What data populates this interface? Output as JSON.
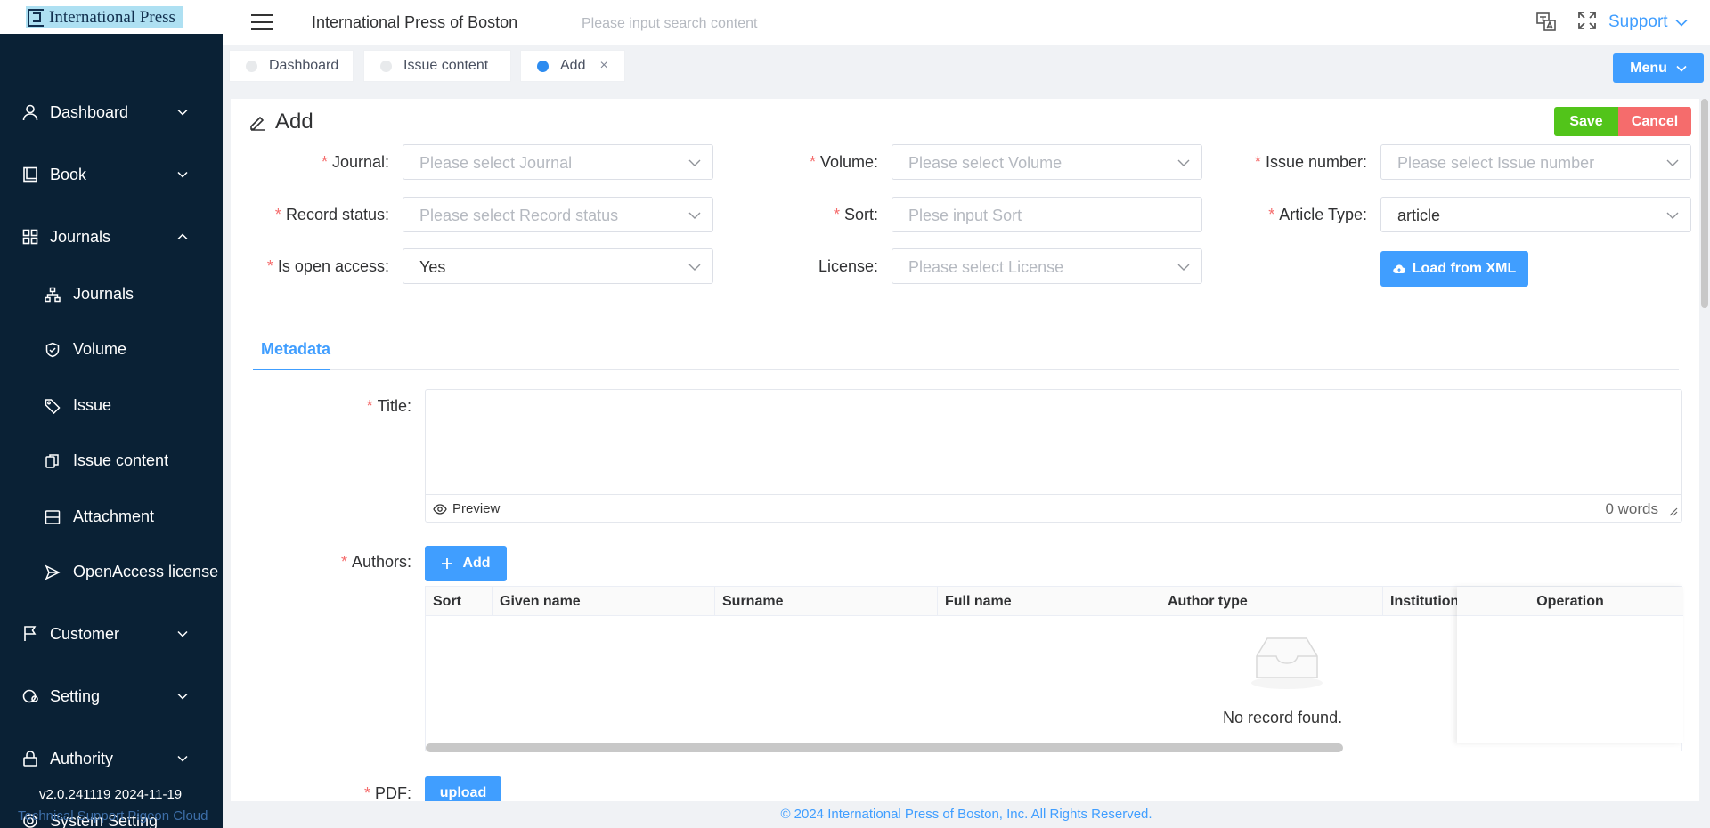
{
  "sidebar": {
    "logo": "International Press",
    "menu": [
      {
        "label": "Dashboard",
        "icon": "user-icon",
        "arrow": "down"
      },
      {
        "label": "Book",
        "icon": "book-icon",
        "arrow": "down"
      },
      {
        "label": "Journals",
        "icon": "grid-icon",
        "arrow": "up"
      }
    ],
    "submenu": [
      {
        "label": "Journals",
        "icon": "sitemap-icon"
      },
      {
        "label": "Volume",
        "icon": "shield-icon"
      },
      {
        "label": "Issue",
        "icon": "tag-icon"
      },
      {
        "label": "Issue content",
        "icon": "copy-icon"
      },
      {
        "label": "Attachment",
        "icon": "attachment-icon"
      },
      {
        "label": "OpenAccess license",
        "icon": "send-icon"
      }
    ],
    "menu2": [
      {
        "label": "Customer",
        "icon": "flag-icon",
        "arrow": "down"
      },
      {
        "label": "Setting",
        "icon": "setting-icon",
        "arrow": "down"
      },
      {
        "label": "Authority",
        "icon": "lock-icon",
        "arrow": "down"
      },
      {
        "label": "System Setting",
        "icon": "gear-icon"
      }
    ],
    "version": "v2.0.241119 2024-11-19",
    "support_line": "Technical Support Pigeon Cloud"
  },
  "header": {
    "title": "International Press of Boston",
    "search_placeholder": "Please input search content",
    "support": "Support"
  },
  "tabs": [
    {
      "label": "Dashboard",
      "active": false
    },
    {
      "label": "Issue content",
      "active": false
    },
    {
      "label": "Add",
      "active": true,
      "close": "×"
    }
  ],
  "menu_button": "Menu",
  "page": {
    "title": "Add",
    "save": "Save",
    "cancel": "Cancel"
  },
  "form": {
    "journal": {
      "label": "Journal:",
      "placeholder": "Please select Journal"
    },
    "volume": {
      "label": "Volume:",
      "placeholder": "Please select Volume"
    },
    "issue_number": {
      "label": "Issue number:",
      "placeholder": "Please select Issue number"
    },
    "record_status": {
      "label": "Record status:",
      "placeholder": "Please select Record status"
    },
    "sort": {
      "label": "Sort:",
      "placeholder": "Plese input Sort"
    },
    "article_type": {
      "label": "Article Type:",
      "value": "article"
    },
    "open_access": {
      "label": "Is open access:",
      "value": "Yes"
    },
    "license": {
      "label": "License:",
      "placeholder": "Please select License"
    },
    "load_xml": "Load from XML"
  },
  "metadata": {
    "tab": "Metadata",
    "title_label": "Title:",
    "preview": "Preview",
    "words": "0 words",
    "authors_label": "Authors:",
    "add": "Add",
    "columns": [
      "Sort",
      "Given name",
      "Surname",
      "Full name",
      "Author type",
      "Institution"
    ],
    "operation": "Operation",
    "empty": "No record found.",
    "pdf_label": "PDF:",
    "upload": "upload"
  },
  "footer": "© 2024 International Press of Boston, Inc. All Rights Reserved."
}
